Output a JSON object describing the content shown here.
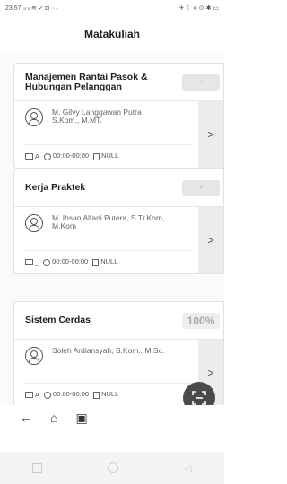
{
  "statusbar": {
    "time": "23.57",
    "left_icons": "ᵢₗ ᵢₗ ≋ ✓ ◘ ···",
    "right_icons": "✈ ☾ ◐ ⊙ ✱ ▭"
  },
  "appbar": {
    "title": "Matakuliah"
  },
  "courses": [
    {
      "name": "Manajemen Rantai Pasok & Hubungan Pelanggan",
      "badge": "-",
      "lecturer": "M. Gilvy Langgawan Putra S.Kom., M.MT.",
      "class": "A",
      "time": "00:00-00:00",
      "room": "NULL",
      "chevron": ">"
    },
    {
      "name": "Kerja Praktek",
      "badge": "-",
      "lecturer": "M. Ihsan Alfani Putera, S.Tr.Kom, M.Kom",
      "class": "_",
      "time": "00:00-00:00",
      "room": "NULL",
      "chevron": ">"
    },
    {
      "name": "Sistem Cerdas",
      "badge": "100%",
      "lecturer": "Soleh Ardiansyah, S.Kom., M.Sc.",
      "class": "A",
      "time": "00:00-00:00",
      "room": "NULL",
      "chevron": ">"
    }
  ],
  "fab": {
    "icon": "scan-icon"
  },
  "bottom_nav": {
    "back": "←",
    "home": "⌂",
    "calendar": "▣"
  },
  "system_nav": {
    "back": "◁"
  }
}
